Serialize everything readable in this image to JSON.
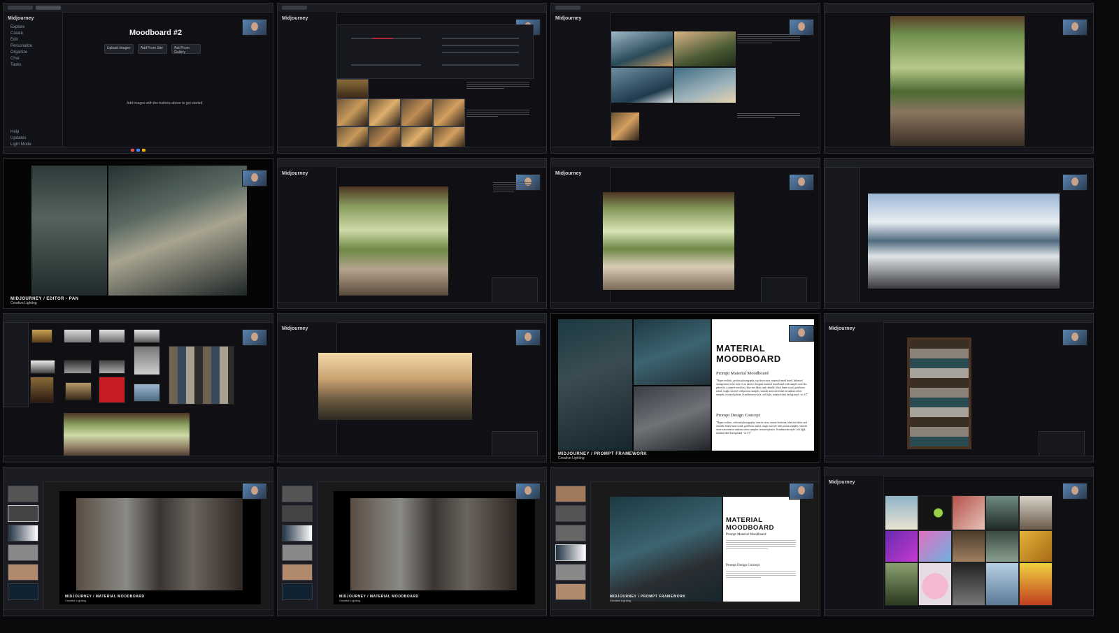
{
  "tiles": {
    "t1": {
      "app": "Midjourney",
      "title": "Moodboard #2",
      "empty_hint": "Add images with the buttons above to get started",
      "buttons": [
        "Upload Images",
        "Add From Site",
        "Add From Gallery"
      ],
      "sidebar": [
        "Explore",
        "Create",
        "Edit",
        "Personalize",
        "Organize",
        "Chat",
        "Tasks",
        "Help",
        "Updates",
        "Light Mode"
      ]
    },
    "t5": {
      "caption": "MIDJOURNEY / EDITOR - PAN",
      "subcaption": "Creative Lighting"
    },
    "t11": {
      "title": "MATERIAL MOODBOARD",
      "section1": "Prompt Material Moodboard",
      "text1": "\"Hyper realistic, product photography, top down view, material mood board, balanced arrangement in the style of an interior designer material moodboard with sample swatches placed in a stained wood tray. blue teal fabric and chenille, black burnt wood, gold brass metal, rough concrete with porous samples, smooth stone travertine in random colors samples, textured plaster, Scandinavian style, soft light, minimal dark background --ar 4:5\"",
      "section2": "Prompt Design Concept",
      "text2": "\"Hyper realistic, editorial photography, interior view, master bedroom, blue teal fabric and chenille, black burnt wood, gold brass metal, rough concrete with porous samples, smooth stone travertine in random colors samples, textured plaster, Scandinavian style, soft light, minimal dark background --ar 4:5\"",
      "caption": "MIDJOURNEY / PROMPT FRAMEWORK",
      "subcaption": "Creative Lighting"
    },
    "t13": {
      "caption": "MIDJOURNEY / MATERIAL MOODBOARD",
      "subcaption": "Creative Lighting"
    },
    "t14": {
      "caption": "MIDJOURNEY / MATERIAL MOODBOARD",
      "subcaption": "Creative Lighting"
    },
    "t15": {
      "title": "MATERIAL MOODBOARD",
      "section1": "Prompt Material Moodboard",
      "section2": "Prompt Design Concept",
      "caption": "MIDJOURNEY / PROMPT FRAMEWORK",
      "subcaption": "Creative Lighting"
    },
    "t16": {
      "app": "Midjourney"
    },
    "t2": {
      "app": "Midjourney"
    },
    "t3": {
      "app": "Midjourney"
    },
    "t6": {
      "app": "Midjourney"
    },
    "t7": {
      "app": "Midjourney"
    },
    "t10": {
      "app": "Midjourney"
    },
    "t12": {
      "app": "Midjourney"
    }
  },
  "colors": {
    "accent": "#b3263a",
    "bg": "#0a0a0c",
    "panel": "#17181d"
  }
}
